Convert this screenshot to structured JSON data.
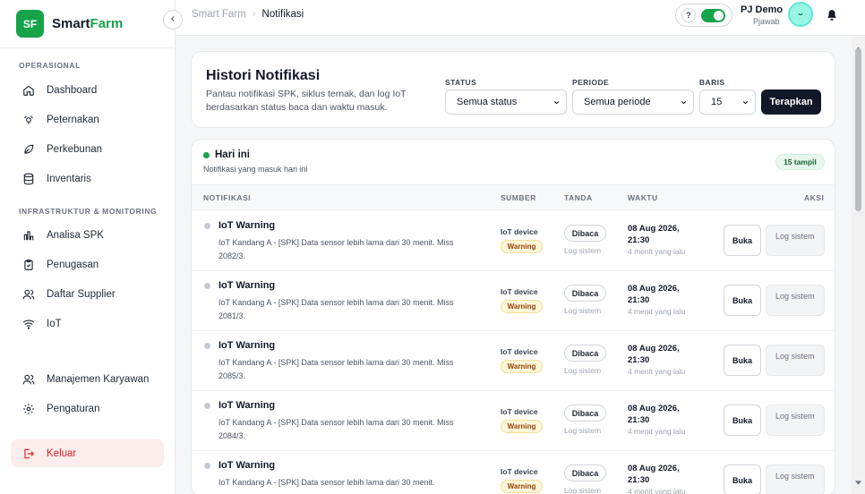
{
  "brand": {
    "logo_text": "SF",
    "name_main": "Smart",
    "name_accent": "Farm",
    "accent_color": "#16a34a"
  },
  "sidebar": {
    "section_operational": "OPERASIONAL",
    "section_infra": "INFRASTRUKTUR & MONITORING",
    "items": [
      {
        "label": "Dashboard",
        "icon": "home-icon"
      },
      {
        "label": "Peternakan",
        "icon": "livestock-icon"
      },
      {
        "label": "Perkebunan",
        "icon": "leaf-icon"
      },
      {
        "label": "Inventaris",
        "icon": "database-icon"
      },
      {
        "label": "Analisa SPK",
        "icon": "bar-chart-icon"
      },
      {
        "label": "Penugasan",
        "icon": "clipboard-icon"
      },
      {
        "label": "Daftar Supplier",
        "icon": "users-icon"
      },
      {
        "label": "IoT",
        "icon": "wifi-icon"
      },
      {
        "label": "Manajemen Karyawan",
        "icon": "users-icon"
      },
      {
        "label": "Pengaturan",
        "icon": "gear-icon"
      }
    ],
    "logout_label": "Keluar",
    "logout_color": "#dc2626"
  },
  "topbar": {
    "breadcrumb_root": "Smart Farm",
    "breadcrumb_sep": "›",
    "breadcrumb_current": "Notifikasi",
    "help_label": "?",
    "user_name": "PJ Demo",
    "user_role": "Pjawab"
  },
  "filters": {
    "title": "Histori Notifikasi",
    "subtitle": "Pantau notifikasi SPK, siklus ternak, dan log IoT berdasarkan status baca dan waktu masuk.",
    "status_label": "STATUS",
    "status_value": "Semua status",
    "period_label": "PERIODE",
    "period_value": "Semua periode",
    "rows_label": "BARIS",
    "rows_value": "15",
    "apply_label": "Terapkan"
  },
  "group": {
    "title": "Hari ini",
    "subtitle": "Notifikasi yang masuk hari ini",
    "count_badge": "15 tampil"
  },
  "table": {
    "columns": [
      "NOTIFIKASI",
      "SUMBER",
      "TANDA",
      "WAKTU",
      "AKSI"
    ],
    "rows": [
      {
        "title": "IoT Warning",
        "desc": "IoT Kandang A - [SPK] Data sensor lebih lama dari 30 menit. Miss 2082/3.",
        "source": "IoT device",
        "level": "Warning",
        "read": "Dibaca",
        "read_source": "Log sistem",
        "date": "08 Aug 2026, 21:30",
        "ago": "4 menit yang lalu",
        "open": "Buka",
        "log": "Log sistem"
      },
      {
        "title": "IoT Warning",
        "desc": "IoT Kandang A - [SPK] Data sensor lebih lama dari 30 menit. Miss 2081/3.",
        "source": "IoT device",
        "level": "Warning",
        "read": "Dibaca",
        "read_source": "Log sistem",
        "date": "08 Aug 2026, 21:30",
        "ago": "4 menit yang lalu",
        "open": "Buka",
        "log": "Log sistem"
      },
      {
        "title": "IoT Warning",
        "desc": "IoT Kandang A - [SPK] Data sensor lebih lama dari 30 menit. Miss 2085/3.",
        "source": "IoT device",
        "level": "Warning",
        "read": "Dibaca",
        "read_source": "Log sistem",
        "date": "08 Aug 2026, 21:30",
        "ago": "4 menit yang lalu",
        "open": "Buka",
        "log": "Log sistem"
      },
      {
        "title": "IoT Warning",
        "desc": "IoT Kandang A - [SPK] Data sensor lebih lama dari 30 menit. Miss 2084/3.",
        "source": "IoT device",
        "level": "Warning",
        "read": "Dibaca",
        "read_source": "Log sistem",
        "date": "08 Aug 2026, 21:30",
        "ago": "4 menit yang lalu",
        "open": "Buka",
        "log": "Log sistem"
      },
      {
        "title": "IoT Warning",
        "desc": "IoT Kandang A - [SPK] Data sensor lebih lama dari 30 menit.",
        "source": "IoT device",
        "level": "Warning",
        "read": "Dibaca",
        "read_source": "Log sistem",
        "date": "08 Aug 2026, 21:30",
        "ago": "4 menit yang lalu",
        "open": "Buka",
        "log": "Log sistem"
      }
    ]
  }
}
